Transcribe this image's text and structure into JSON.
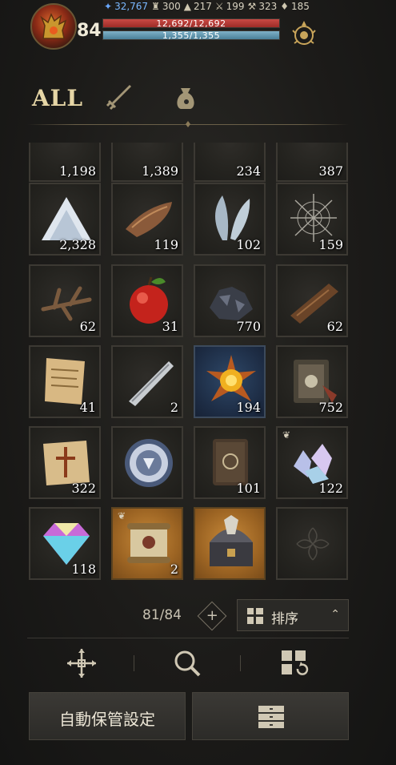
{
  "player": {
    "level": "84"
  },
  "currencies": [
    {
      "icon": "feather-gem-icon",
      "value": "32,767"
    },
    {
      "icon": "helmet-icon",
      "value": "300"
    },
    {
      "icon": "cauldron-icon",
      "value": "217"
    },
    {
      "icon": "sword-icon",
      "value": "199"
    },
    {
      "icon": "hammer-icon",
      "value": "323"
    },
    {
      "icon": "bell-icon",
      "value": "185"
    }
  ],
  "hp": {
    "text": "12,692/12,692",
    "fraction": 1.0,
    "color": "#b8332e"
  },
  "mp": {
    "text": "1,355/1,355",
    "fraction": 1.0,
    "color": "#6fa3bb"
  },
  "tabs": {
    "all_label": "ALL"
  },
  "inventory": {
    "rows": [
      [
        {
          "item": "spider-root",
          "count": "1,198"
        },
        {
          "item": "ore-crystal",
          "count": "1,389"
        },
        {
          "item": "log-bundle",
          "count": "234"
        },
        {
          "item": "web-cluster",
          "count": "387"
        }
      ],
      [
        {
          "item": "salt-pile",
          "count": "2,328"
        },
        {
          "item": "bark-hide",
          "count": "119"
        },
        {
          "item": "insect-wing",
          "count": "102"
        },
        {
          "item": "cobweb",
          "count": "159"
        }
      ],
      [
        {
          "item": "dry-branch",
          "count": "62"
        },
        {
          "item": "red-apple",
          "count": "31"
        },
        {
          "item": "coal-ore",
          "count": "770"
        },
        {
          "item": "wood-plank",
          "count": "62"
        }
      ],
      [
        {
          "item": "torn-scroll",
          "count": "41"
        },
        {
          "item": "blade-fragment",
          "count": "2"
        },
        {
          "item": "sun-gem-star",
          "count": "194",
          "bg": "blue"
        },
        {
          "item": "spellbook-bundle",
          "count": "752"
        }
      ],
      [
        {
          "item": "cross-map",
          "count": "322"
        },
        {
          "item": "rune-medallion",
          "count": ""
        },
        {
          "item": "leather-tome",
          "count": "101"
        },
        {
          "item": "crystal-shards",
          "count": "122",
          "bagmark": true
        }
      ],
      [
        {
          "item": "prism-diamond",
          "count": "118"
        },
        {
          "item": "ancient-scroll",
          "count": "2",
          "bg": "gold",
          "bagmark": true
        },
        {
          "item": "dragon-chest",
          "count": "",
          "bg": "gold"
        },
        {
          "item": "empty",
          "count": ""
        }
      ]
    ]
  },
  "capacity": "81/84",
  "sort": {
    "label": "排序"
  },
  "buttons": {
    "auto_store": "自動保管設定"
  }
}
